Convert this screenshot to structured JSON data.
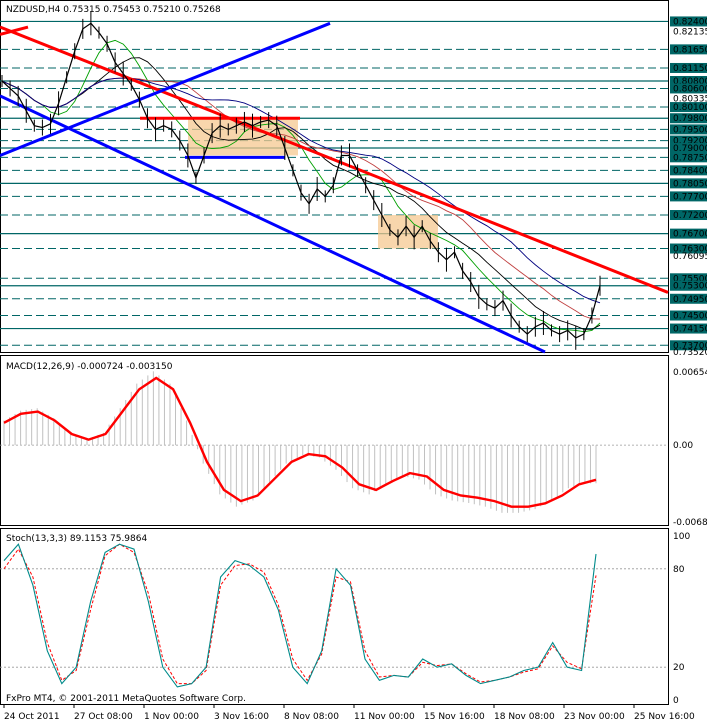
{
  "symbol_header": "NZDUSD,H4  0.75315 0.75453 0.75210 0.75268",
  "copyright": "FxPro MT4, © 2001-2011 MetaQuotes Software Corp.",
  "colors": {
    "price_line": "#000000",
    "resistance_line": "#ff0000",
    "channel_line": "#0000ff",
    "level_line": "#006666",
    "consolidation_box": "#f5c890",
    "macd_signal": "#ff0000",
    "macd_hist": "#c0c0c0",
    "stoch_main": "#008b8b",
    "stoch_signal": "#ff0000",
    "ma_fast": "#00a000",
    "ma_mid": "#000000",
    "ma_slow_red": "#c04040",
    "ma_slow_blue": "#000080"
  },
  "chart_data": [
    {
      "type": "line",
      "panel": "price",
      "title": "NZDUSD,H4  0.75315 0.75453 0.75210 0.75268",
      "ylim": [
        0.7352,
        0.826
      ],
      "y_tick_labels": [
        "0.82400",
        "0.82135",
        "0.81650",
        "0.81150",
        "0.80800",
        "0.80600",
        "0.80335",
        "0.80100",
        "0.79800",
        "0.79500",
        "0.79200",
        "0.79000",
        "0.78750",
        "0.78400",
        "0.78050",
        "0.77700",
        "0.77200",
        "0.76700",
        "0.76300",
        "0.76095",
        "0.75500",
        "0.75300",
        "0.74950",
        "0.74500",
        "0.74150",
        "0.73700",
        "0.73520"
      ],
      "x_tick_labels": [
        "24 Oct 2011",
        "27 Oct 08:00",
        "1 Nov 00:00",
        "3 Nov 16:00",
        "8 Nov 08:00",
        "11 Nov 00:00",
        "15 Nov 16:00",
        "18 Nov 08:00",
        "23 Nov 00:00",
        "25 Nov 16:00"
      ],
      "horizontal_levels": [
        0.824,
        0.8165,
        0.8115,
        0.808,
        0.806,
        0.801,
        0.798,
        0.795,
        0.792,
        0.79,
        0.7875,
        0.784,
        0.7805,
        0.777,
        0.772,
        0.767,
        0.763,
        0.755,
        0.753,
        0.7495,
        0.745,
        0.7415,
        0.737
      ],
      "close_series": [
        0.808,
        0.806,
        0.804,
        0.8,
        0.796,
        0.7955,
        0.7965,
        0.802,
        0.809,
        0.816,
        0.822,
        0.8235,
        0.821,
        0.818,
        0.813,
        0.81,
        0.807,
        0.803,
        0.798,
        0.795,
        0.796,
        0.795,
        0.792,
        0.788,
        0.782,
        0.788,
        0.794,
        0.796,
        0.795,
        0.796,
        0.797,
        0.796,
        0.797,
        0.7975,
        0.796,
        0.79,
        0.784,
        0.778,
        0.775,
        0.779,
        0.777,
        0.78,
        0.788,
        0.788,
        0.784,
        0.78,
        0.776,
        0.772,
        0.768,
        0.766,
        0.769,
        0.766,
        0.769,
        0.765,
        0.762,
        0.76,
        0.762,
        0.757,
        0.754,
        0.75,
        0.748,
        0.747,
        0.749,
        0.745,
        0.742,
        0.74,
        0.742,
        0.743,
        0.741,
        0.74,
        0.741,
        0.739,
        0.74,
        0.745,
        0.753
      ],
      "trend_lines": [
        {
          "name": "red resistance",
          "color": "#ff0000",
          "x": [
            0,
            1
          ],
          "y": [
            0.8205,
            0.8205
          ]
        },
        {
          "name": "red resistance main",
          "color": "#ff0000",
          "x": [
            0,
            1
          ],
          "y": [
            0.8225,
            0.7505
          ]
        }
      ]
    },
    {
      "type": "line",
      "panel": "macd",
      "title": "MACD(12,26,9) -0.000724 -0.003150",
      "ylim": [
        -0.00687,
        0.00654
      ],
      "y_tick_labels": [
        "0.00654",
        "0.00",
        "-0.00687"
      ],
      "signal_series": [
        0.002,
        0.0028,
        0.003,
        0.0022,
        0.001,
        0.0005,
        0.001,
        0.003,
        0.005,
        0.006,
        0.005,
        0.002,
        -0.0015,
        -0.004,
        -0.005,
        -0.0045,
        -0.003,
        -0.0015,
        -0.0008,
        -0.001,
        -0.002,
        -0.0035,
        -0.004,
        -0.0032,
        -0.0025,
        -0.0028,
        -0.004,
        -0.0045,
        -0.0047,
        -0.005,
        -0.0055,
        -0.0055,
        -0.0052,
        -0.0045,
        -0.0035,
        -0.0031
      ]
    },
    {
      "type": "line",
      "panel": "stochastic",
      "title": "Stoch(13,3,3) 89.1153 75.9864",
      "ylim": [
        0,
        100
      ],
      "y_tick_labels": [
        "100",
        "80",
        "20",
        "0"
      ],
      "main_series": [
        85,
        95,
        70,
        30,
        10,
        20,
        60,
        90,
        95,
        92,
        60,
        20,
        8,
        10,
        20,
        75,
        85,
        82,
        75,
        55,
        20,
        10,
        30,
        80,
        70,
        25,
        12,
        15,
        14,
        25,
        20,
        22,
        15,
        10,
        12,
        14,
        18,
        20,
        35,
        20,
        18,
        89
      ],
      "signal_series": [
        80,
        92,
        75,
        35,
        12,
        18,
        55,
        88,
        95,
        90,
        65,
        25,
        10,
        10,
        18,
        70,
        82,
        83,
        78,
        58,
        25,
        12,
        28,
        75,
        72,
        30,
        14,
        15,
        14,
        23,
        21,
        22,
        16,
        11,
        12,
        14,
        17,
        19,
        33,
        23,
        19,
        76
      ]
    }
  ]
}
